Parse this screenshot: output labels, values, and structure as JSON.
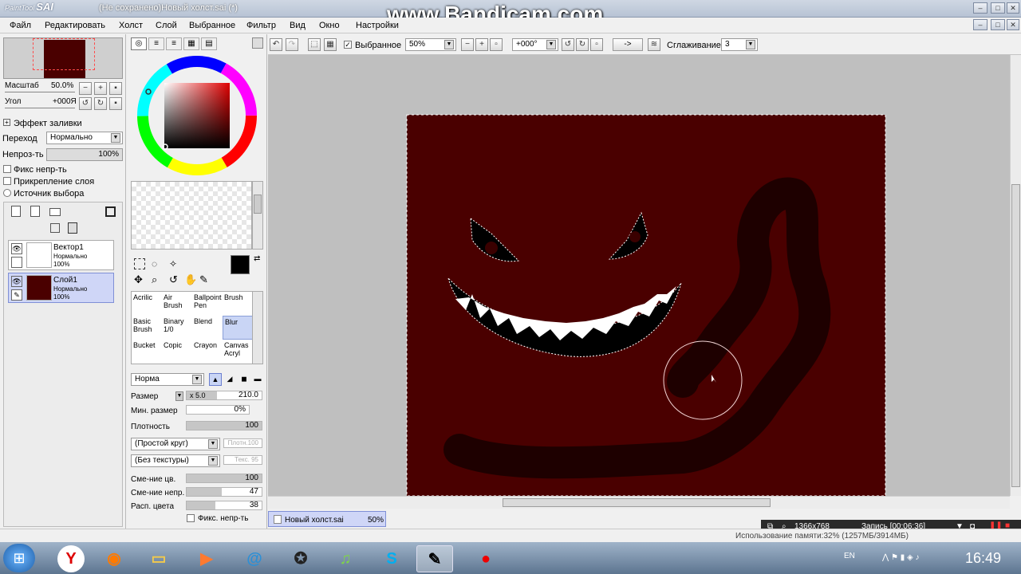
{
  "window": {
    "app_name": "PaintTool",
    "app_name_bold": "SAI",
    "title": "(Не сохранено)Новый холст.sai (*)",
    "watermark": "www.Bandicam.com"
  },
  "menu": [
    "Файл",
    "Редактировать",
    "Холст",
    "Слой",
    "Выбранное",
    "Фильтр",
    "Вид",
    "Окно",
    "Настройки"
  ],
  "navigator": {
    "zoom_label": "Масштаб",
    "zoom_value": "50.0%",
    "angle_label": "Угол",
    "angle_value": "+000Я"
  },
  "fill_effect": "Эффект заливки",
  "blend": {
    "label": "Переход",
    "value": "Нормально"
  },
  "opacity": {
    "label": "Непроз-ть",
    "value": "100%"
  },
  "options": [
    "Фикс непр-ть",
    "Прикрепление слоя",
    "Источник выбора"
  ],
  "layers": [
    {
      "name": "Вектор1",
      "mode": "Нормально",
      "opacity": "100%"
    },
    {
      "name": "Слой1",
      "mode": "Нормально",
      "opacity": "100%"
    }
  ],
  "tool_settings": {
    "mode": "Норма",
    "size_label": "Размер",
    "size_mult": "x 5.0",
    "size_value": "210.0",
    "min_size_label": "Мин. размер",
    "min_size_value": "0%",
    "density_label": "Плотность",
    "density_value": "100",
    "shape": "(Простой круг)",
    "shape_strength": "Плотн.100",
    "texture": "(Без текстуры)",
    "texture_strength": "Текс. 95",
    "blend_color_label": "Сме-ние цв.",
    "blend_color_value": "100",
    "blend_density_label": "Сме-ние непр.",
    "blend_density_value": "47",
    "spread_label": "Расп. цвета",
    "spread_value": "38",
    "fix_opacity_label": "Фикс. непр-ть",
    "level_blend_color": 1.0,
    "level_blend_density": 0.47,
    "level_spread": 0.38
  },
  "brushes": [
    [
      "Acrilic",
      ""
    ],
    [
      "Air",
      "Brush"
    ],
    [
      "Ballpoint",
      "Pen"
    ],
    [
      "Brush",
      ""
    ],
    [
      "Basic",
      "Brush"
    ],
    [
      "Binary",
      "1/0"
    ],
    [
      "Blend",
      ""
    ],
    [
      "Blur",
      ""
    ],
    [
      "Bucket",
      ""
    ],
    [
      "Copic",
      ""
    ],
    [
      "Crayon",
      ""
    ],
    [
      "Canvas",
      "Acryl"
    ]
  ],
  "toolbar": {
    "selection_label": "Выбранное",
    "zoom": "50%",
    "angle": "+000°",
    "arrow": "->",
    "smoothing_label": "Сглаживание",
    "smoothing_value": "3"
  },
  "canvas_tab": {
    "name": "Новый холст.sai",
    "zoom": "50%"
  },
  "bandicam": {
    "resolution": "1366x768",
    "record": "Запись [00:06:36]"
  },
  "memory": "Использование памяти:32% (1257МБ/3914МБ)",
  "tray": {
    "lang": "EN",
    "time": "16:49"
  },
  "colors": {
    "canvas": "#4a0000",
    "stroke": "#1a0000",
    "primary": "#000000"
  }
}
